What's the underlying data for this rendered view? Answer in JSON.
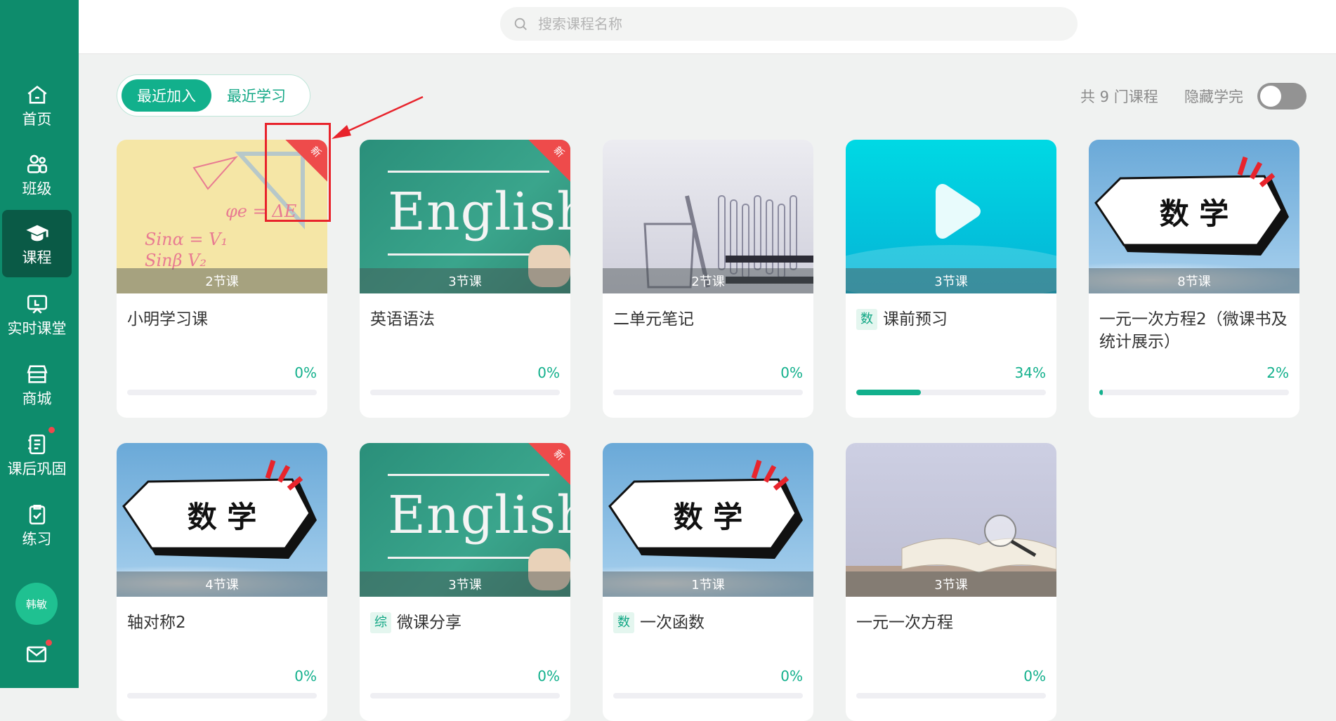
{
  "sidebar": {
    "items": [
      {
        "label": "首页",
        "icon": "home-icon"
      },
      {
        "label": "班级",
        "icon": "class-icon"
      },
      {
        "label": "课程",
        "icon": "graduation-cap-icon",
        "active": true
      },
      {
        "label": "实时课堂",
        "icon": "live-board-icon"
      },
      {
        "label": "商城",
        "icon": "store-icon"
      },
      {
        "label": "课后巩固",
        "icon": "notebook-icon",
        "has_dot": true
      },
      {
        "label": "练习",
        "icon": "clipboard-check-icon"
      }
    ],
    "avatar": "韩敏",
    "mail_has_dot": true
  },
  "search": {
    "placeholder": "搜索课程名称"
  },
  "tabs": {
    "recent_added": "最近加入",
    "recent_studied": "最近学习",
    "active": "最近加入"
  },
  "summary": {
    "count_text": "共 9 门课程",
    "hide_label": "隐藏学完",
    "hide_completed": false
  },
  "new_badge_text": "新",
  "courses": [
    {
      "title": "小明学习课",
      "lessons": "2节课",
      "progress_text": "0%",
      "progress": 0,
      "is_new": true,
      "tag": "",
      "cover": "math-notes"
    },
    {
      "title": "英语语法",
      "lessons": "3节课",
      "progress_text": "0%",
      "progress": 0,
      "is_new": true,
      "tag": "",
      "cover": "english-board"
    },
    {
      "title": "二单元笔记",
      "lessons": "2节课",
      "progress_text": "0%",
      "progress": 0,
      "is_new": false,
      "tag": "",
      "cover": "test-tubes"
    },
    {
      "title": "课前预习",
      "lessons": "3节课",
      "progress_text": "34%",
      "progress": 34,
      "is_new": false,
      "tag": "数",
      "cover": "video-play"
    },
    {
      "title": "一元一次方程2（微课书及统计展示）",
      "lessons": "8节课",
      "progress_text": "2%",
      "progress": 2,
      "is_new": false,
      "tag": "",
      "cover": "math-sign"
    },
    {
      "title": "轴对称2",
      "lessons": "4节课",
      "progress_text": "0%",
      "progress": 0,
      "is_new": false,
      "tag": "",
      "cover": "math-sign"
    },
    {
      "title": "微课分享",
      "lessons": "3节课",
      "progress_text": "0%",
      "progress": 0,
      "is_new": true,
      "tag": "综",
      "cover": "english-board"
    },
    {
      "title": "一次函数",
      "lessons": "1节课",
      "progress_text": "0%",
      "progress": 0,
      "is_new": false,
      "tag": "数",
      "cover": "math-sign"
    },
    {
      "title": "一元一次方程",
      "lessons": "3节课",
      "progress_text": "0%",
      "progress": 0,
      "is_new": false,
      "tag": "",
      "cover": "open-book"
    }
  ],
  "sign_text": "数 学",
  "english_text": "English",
  "colors": {
    "sidebar": "#0e8c6c",
    "accent": "#12b08c",
    "badge": "#ee4b4b",
    "annotation": "#e8242c"
  }
}
